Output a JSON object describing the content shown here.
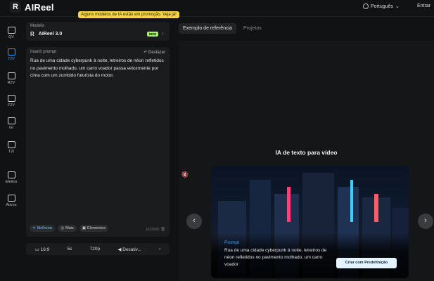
{
  "app": {
    "name": "AIReel",
    "logo_letter": "R"
  },
  "header": {
    "promo": "Alguns modelos de IA estão em promoção. Veja já!",
    "language": "Português",
    "login": "Entrar"
  },
  "rail": [
    {
      "label": "QV",
      "icon": "video-grid-icon"
    },
    {
      "label": "T2V",
      "icon": "text-to-video-icon",
      "active": true
    },
    {
      "label": "R2V",
      "icon": "reference-video-icon"
    },
    {
      "label": "F2V",
      "icon": "frame-video-icon"
    },
    {
      "label": "GI",
      "icon": "image-gen-icon"
    },
    {
      "label": "T2I",
      "icon": "text-image-icon"
    },
    {
      "label": "Efeitos",
      "icon": "effects-icon"
    },
    {
      "label": "Ativos",
      "icon": "folder-icon"
    }
  ],
  "model": {
    "label": "Modelo",
    "name": "AIReel 3.0",
    "badge": "NEW"
  },
  "prompt": {
    "label": "Inserir prompt",
    "undo": "Desfazer",
    "text": "Rua de uma cidade cyberpunk à noite, letreiros de néon refletidos no pavimento molhado, um carro voador passa velozmente por cima com um zumbido futurista do motor.",
    "chips": [
      "Melhorar",
      "Mais",
      "Elementos"
    ],
    "counter": "162/500"
  },
  "settings": {
    "ratio": "16:9",
    "duration": "5s",
    "resolution": "720p",
    "audio": "Desativ..."
  },
  "tabs": [
    "Exemplo de referência",
    "Projetos"
  ],
  "showcase": {
    "title": "IA de texto para vídeo",
    "prompt_label": "Prompt",
    "prompt_text": "Rua de uma cidade cyberpunk à noite, letreiros de néon refletidos no pavimento molhado, um carro voador",
    "button": "Criar com Predefinição"
  },
  "colors": {
    "accent": "#3aa3ff",
    "promo": "#f5d547",
    "new_badge": "#a7f070"
  }
}
